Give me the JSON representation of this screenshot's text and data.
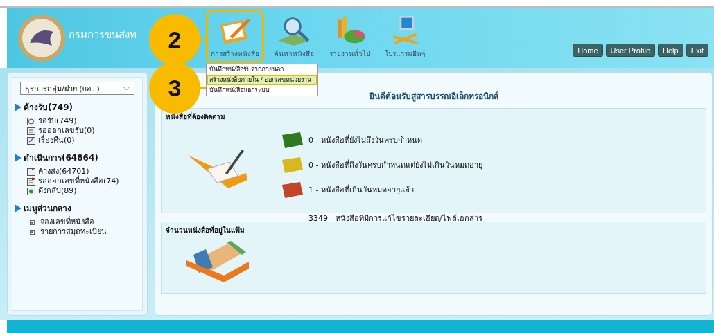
{
  "header": {
    "org_name": "กรมการขนส่งท",
    "menu": [
      {
        "label": "การสร้างหนังสือ",
        "kind": "create",
        "highlighted": true
      },
      {
        "label": "ค้นหาหนังสือ",
        "kind": "search",
        "highlighted": false
      },
      {
        "label": "รายงานทั่วไป",
        "kind": "report",
        "highlighted": false
      },
      {
        "label": "โปรแกรมอื่นๆ",
        "kind": "tools",
        "highlighted": false
      }
    ],
    "buttons": [
      "Home",
      "User Profile",
      "Help",
      "Exit"
    ]
  },
  "dropdown": [
    {
      "label": "บันทึกหนังสือรับจากภายนอก",
      "highlighted": false
    },
    {
      "label": "สร้างหนังสือภายใน / ออกเลขหน่วยงาน",
      "highlighted": true
    },
    {
      "label": "บันทึกหนังสือนอกระบบ",
      "highlighted": false
    }
  ],
  "callouts": [
    {
      "number": "2"
    },
    {
      "number": "3"
    }
  ],
  "sidebar": {
    "unit_select": "ธุรการกลุ่ม/ฝ่าย (บอ. )",
    "groups": [
      {
        "title": "ค้างรับ(749)",
        "items": [
          {
            "label": "รอรับ(749)",
            "kind": "clock"
          },
          {
            "label": "รอออกเลขรับ(0)",
            "kind": "number"
          },
          {
            "label": "เรื่องคืน(0)",
            "kind": "return"
          }
        ]
      },
      {
        "title": "ดำเนินการ(64864)",
        "items": [
          {
            "label": "ค้างส่ง(64701)",
            "kind": "send"
          },
          {
            "label": "รอออกเลขที่หนังสือ(74)",
            "kind": "numbersend"
          },
          {
            "label": "ดึงกลับ(89)",
            "kind": "pull"
          }
        ]
      },
      {
        "title": "เมนูส่วนกลาง",
        "items": [
          {
            "label": "จองเลขที่หนังสือ",
            "kind": "bullet"
          },
          {
            "label": "รายการสมุดทะเบียน",
            "kind": "bullet"
          }
        ]
      }
    ]
  },
  "main": {
    "welcome": "ยินดีต้อนรับสู่สารบรรณอิเล็กทรอนิกส์",
    "tracking": {
      "title": "หนังสือที่ต้องติดตาม",
      "rows": [
        {
          "text": "0 - หนังสือที่ยังไม่ถึงวันครบกำหนด",
          "color": "#2f7a1e"
        },
        {
          "text": "0 - หนังสือที่ถึงวันครบกำหนดแต่ยังไม่เกินวันหมดอายุ",
          "color": "#d9b81c"
        },
        {
          "text": "1 - หนังสือที่เกินวันหมดอายุแล้ว",
          "color": "#c4442a"
        }
      ],
      "edited": "3349 - หนังสือที่มีการแก้ไขรายละเอียด/ไฟล์เอกสาร"
    },
    "folders": {
      "title": "จำนวนหนังสือที่อยู่ในแฟ้ม"
    }
  }
}
